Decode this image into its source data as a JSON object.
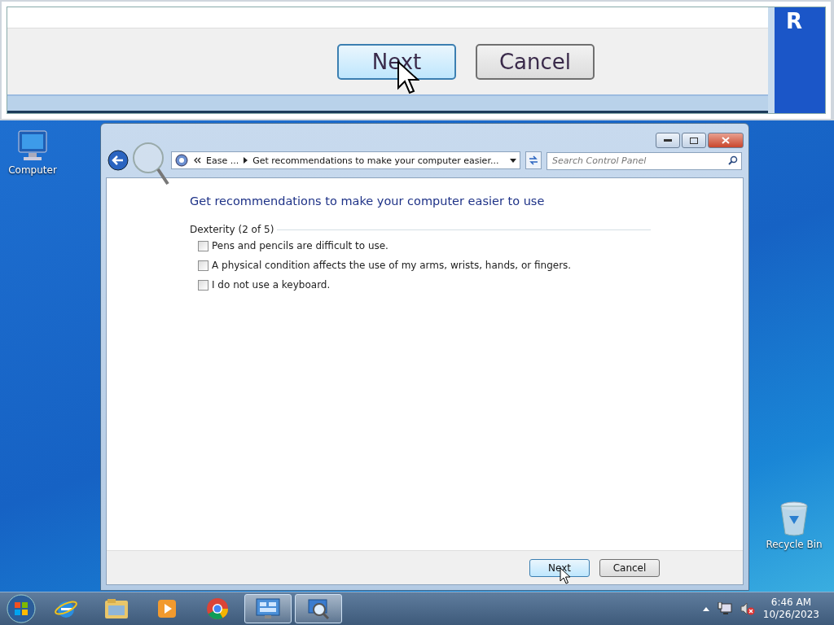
{
  "magnifier": {
    "buttons": [
      {
        "label": "Next",
        "hovered": true
      },
      {
        "label": "Cancel",
        "hovered": false
      }
    ],
    "edge_text": "R"
  },
  "desktop_icons": [
    {
      "kind": "computer",
      "label": "Computer"
    },
    {
      "kind": "recycle",
      "label": "Recycle Bin"
    }
  ],
  "window": {
    "breadcrumb": [
      "Ease ...",
      "Get recommendations to make your computer easier..."
    ],
    "search": {
      "placeholder": "Search Control Panel"
    },
    "heading": "Get recommendations to make your computer easier to use",
    "group": {
      "title": "Dexterity (2 of 5)",
      "options": [
        {
          "label": "Pens and pencils are difficult to use.",
          "checked": false
        },
        {
          "label": "A physical condition affects the use of my arms, wrists, hands, or fingers.",
          "checked": false
        },
        {
          "label": "I do not use a keyboard.",
          "checked": false
        }
      ]
    },
    "buttons": [
      {
        "label": "Next",
        "hovered": true
      },
      {
        "label": "Cancel",
        "hovered": false
      }
    ]
  },
  "taskbar": {
    "apps": [
      {
        "kind": "ie",
        "active": false
      },
      {
        "kind": "explorer",
        "active": false
      },
      {
        "kind": "media",
        "active": false
      },
      {
        "kind": "chrome",
        "active": false
      },
      {
        "kind": "control",
        "active": true
      },
      {
        "kind": "magnifier",
        "active": true
      }
    ],
    "clock": {
      "time": "6:46 AM",
      "date": "10/26/2023"
    }
  }
}
